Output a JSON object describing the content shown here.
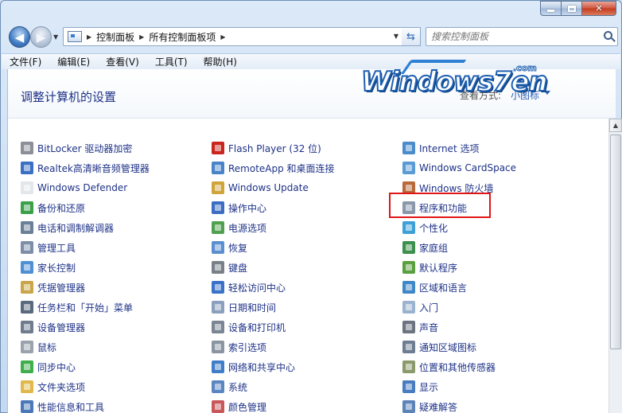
{
  "window": {
    "min_label": "",
    "max_label": "",
    "close_label": "✕"
  },
  "nav": {
    "breadcrumb": [
      "控制面板",
      "所有控制面板项"
    ],
    "search_placeholder": "搜索控制面板"
  },
  "menu": [
    "文件(F)",
    "编辑(E)",
    "查看(V)",
    "工具(T)",
    "帮助(H)"
  ],
  "header": {
    "title": "调整计算机的设置",
    "view_by_label": "查看方式:",
    "view_by_value": "小图标"
  },
  "logo": {
    "text": "Windows7en",
    "suffix": ".com"
  },
  "columns": [
    [
      {
        "label": "BitLocker 驱动器加密",
        "icon": "bitlocker-icon",
        "color": "#8a8f98"
      },
      {
        "label": "Realtek高清晰音频管理器",
        "icon": "realtek-icon",
        "color": "#3a6fc4"
      },
      {
        "label": "Windows Defender",
        "icon": "defender-icon",
        "color": "#e3e6ea"
      },
      {
        "label": "备份和还原",
        "icon": "backup-icon",
        "color": "#3aa04a"
      },
      {
        "label": "电话和调制解调器",
        "icon": "phone-modem-icon",
        "color": "#6a7f98"
      },
      {
        "label": "管理工具",
        "icon": "admin-tools-icon",
        "color": "#7d8fa8"
      },
      {
        "label": "家长控制",
        "icon": "parental-control-icon",
        "color": "#4f8fd4"
      },
      {
        "label": "凭据管理器",
        "icon": "credential-icon",
        "color": "#c9a64a"
      },
      {
        "label": "任务栏和「开始」菜单",
        "icon": "taskbar-icon",
        "color": "#5a6a7e"
      },
      {
        "label": "设备管理器",
        "icon": "device-manager-icon",
        "color": "#6f7c8e"
      },
      {
        "label": "鼠标",
        "icon": "mouse-icon",
        "color": "#9aa3ad"
      },
      {
        "label": "同步中心",
        "icon": "sync-icon",
        "color": "#3fae4c"
      },
      {
        "label": "文件夹选项",
        "icon": "folder-options-icon",
        "color": "#e0b84c"
      },
      {
        "label": "性能信息和工具",
        "icon": "performance-icon",
        "color": "#4a78b8"
      }
    ],
    [
      {
        "label": "Flash Player (32 位)",
        "icon": "flash-icon",
        "color": "#c8261e"
      },
      {
        "label": "RemoteApp 和桌面连接",
        "icon": "remoteapp-icon",
        "color": "#4a84c8"
      },
      {
        "label": "Windows Update",
        "icon": "windows-update-icon",
        "color": "#d1a43a"
      },
      {
        "label": "操作中心",
        "icon": "action-center-icon",
        "color": "#3b6ec2"
      },
      {
        "label": "电源选项",
        "icon": "power-icon",
        "color": "#4fa04f"
      },
      {
        "label": "恢复",
        "icon": "recovery-icon",
        "color": "#5c8fd0"
      },
      {
        "label": "键盘",
        "icon": "keyboard-icon",
        "color": "#7a8088"
      },
      {
        "label": "轻松访问中心",
        "icon": "ease-access-icon",
        "color": "#3a72c8"
      },
      {
        "label": "日期和时间",
        "icon": "datetime-icon",
        "color": "#8aa0bc"
      },
      {
        "label": "设备和打印机",
        "icon": "printer-icon",
        "color": "#7a8694"
      },
      {
        "label": "索引选项",
        "icon": "index-icon",
        "color": "#8b95a2"
      },
      {
        "label": "网络和共享中心",
        "icon": "network-icon",
        "color": "#3f7dc8"
      },
      {
        "label": "系统",
        "icon": "system-icon",
        "color": "#5a86c2"
      },
      {
        "label": "颜色管理",
        "icon": "color-mgmt-icon",
        "color": "#c8585a"
      }
    ],
    [
      {
        "label": "Internet 选项",
        "icon": "internet-options-icon",
        "color": "#4c8ccc"
      },
      {
        "label": "Windows CardSpace",
        "icon": "cardspace-icon",
        "color": "#5a9bd6"
      },
      {
        "label": "Windows 防火墙",
        "icon": "firewall-icon",
        "color": "#b86a3a"
      },
      {
        "label": "程序和功能",
        "icon": "programs-features-icon",
        "color": "#8a98aa"
      },
      {
        "label": "个性化",
        "icon": "personalize-icon",
        "color": "#3fa0d8"
      },
      {
        "label": "家庭组",
        "icon": "homegroup-icon",
        "color": "#3c8f4c"
      },
      {
        "label": "默认程序",
        "icon": "default-programs-icon",
        "color": "#5aa040"
      },
      {
        "label": "区域和语言",
        "icon": "region-icon",
        "color": "#3f88c8"
      },
      {
        "label": "入门",
        "icon": "getting-started-icon",
        "color": "#9bb3cf"
      },
      {
        "label": "声音",
        "icon": "sound-icon",
        "color": "#6c7480"
      },
      {
        "label": "通知区域图标",
        "icon": "notify-area-icon",
        "color": "#6e7e92"
      },
      {
        "label": "位置和其他传感器",
        "icon": "sensor-icon",
        "color": "#8a9a6c"
      },
      {
        "label": "显示",
        "icon": "display-icon",
        "color": "#4a7cc0"
      },
      {
        "label": "疑难解答",
        "icon": "troubleshoot-icon",
        "color": "#5c84b8"
      }
    ]
  ]
}
